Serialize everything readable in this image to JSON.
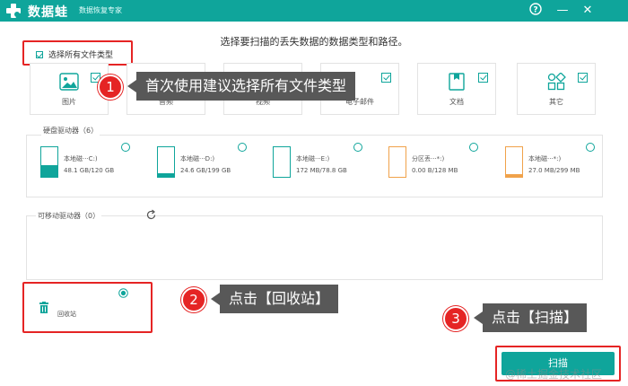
{
  "app": {
    "name": "数据蛙",
    "subtitle": "数据恢复专家"
  },
  "window_controls": {
    "help": "?",
    "minimize": "—",
    "close": "✕"
  },
  "prompt": "选择要扫描的丢失数据的数据类型和路径。",
  "select_all": {
    "label": "选择所有文件类型",
    "checked": true
  },
  "file_types": [
    {
      "label": "图片",
      "checked": true,
      "icon": "image-icon"
    },
    {
      "label": "音频",
      "checked": true,
      "icon": "audio-icon"
    },
    {
      "label": "视频",
      "checked": true,
      "icon": "video-icon"
    },
    {
      "label": "电子邮件",
      "checked": true,
      "icon": "email-icon"
    },
    {
      "label": "文档",
      "checked": true,
      "icon": "document-icon"
    },
    {
      "label": "其它",
      "checked": true,
      "icon": "other-icon"
    }
  ],
  "hard_drives": {
    "title": "硬盘驱动器（6）",
    "drives": [
      {
        "name": "本地磁···C:)",
        "size": "48.1 GB/120 GB",
        "used_fraction": 0.4,
        "color": "#0fa59b"
      },
      {
        "name": "本地磁···D:)",
        "size": "24.6 GB/199 GB",
        "used_fraction": 0.12,
        "color": "#0fa59b"
      },
      {
        "name": "本地磁···E:)",
        "size": "172 MB/78.8 GB",
        "used_fraction": 0.0,
        "color": "#0fa59b"
      },
      {
        "name": "分区丢···*:)",
        "size": "0.00  B/128 MB",
        "used_fraction": 0.0,
        "color": "#f0a24a"
      },
      {
        "name": "本地磁···*:)",
        "size": "27.0 MB/299 MB",
        "used_fraction": 0.09,
        "color": "#f0a24a"
      }
    ]
  },
  "removable": {
    "title": "可移动驱动器（0）",
    "refresh_icon": "refresh-icon"
  },
  "recycle_bin": {
    "label": "回收站",
    "selected": true
  },
  "callouts": [
    {
      "number": "1",
      "text": "首次使用建议选择所有文件类型"
    },
    {
      "number": "2",
      "text": "点击【回收站】"
    },
    {
      "number": "3",
      "text": "点击【扫描】"
    }
  ],
  "scan_button": "扫描",
  "watermark": "@稀土掘金技术社区",
  "colors": {
    "accent": "#0fa59b",
    "highlight": "#e52424",
    "callout_bg": "#585858",
    "warning": "#f0a24a"
  }
}
